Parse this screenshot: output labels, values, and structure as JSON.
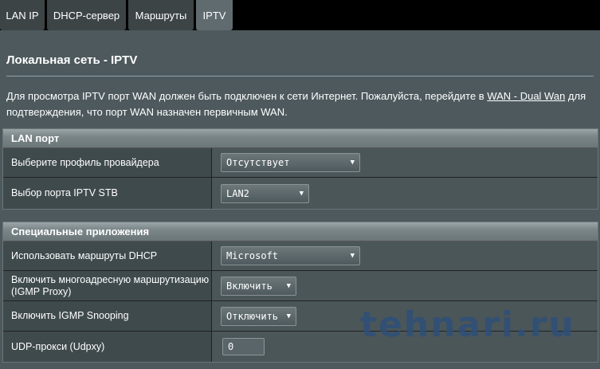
{
  "tabs": [
    {
      "label": "LAN IP",
      "active": false
    },
    {
      "label": "DHCP-сервер",
      "active": false
    },
    {
      "label": "Маршруты",
      "active": false
    },
    {
      "label": "IPTV",
      "active": true
    }
  ],
  "page": {
    "title": "Локальная сеть - IPTV",
    "description_before": "Для просмотра IPTV порт WAN должен быть подключен к сети Интернет. Пожалуйста, перейдите в ",
    "description_link": "WAN - Dual Wan",
    "description_after": " для подтверждения, что порт WAN назначен первичным WAN."
  },
  "sections": {
    "lan": {
      "header": "LAN порт",
      "provider_label": "Выберите профиль провайдера",
      "provider_value": "Отсутствует",
      "stb_label": "Выбор порта IPTV STB",
      "stb_value": "LAN2"
    },
    "apps": {
      "header": "Специальные приложения",
      "dhcp_routes_label": "Использовать маршруты DHCP",
      "dhcp_routes_value": "Microsoft",
      "igmp_proxy_label": "Включить многоадресную маршрутизацию (IGMP Proxy)",
      "igmp_proxy_value": "Включить",
      "igmp_snooping_label": "Включить IGMP Snooping",
      "igmp_snooping_value": "Отключить",
      "udpxy_label": "UDP-прокси (Udpxy)",
      "udpxy_value": "0"
    }
  },
  "icons": {
    "dropdown": "chevron-down-icon"
  },
  "watermark": "tehnari.ru",
  "colors": {
    "panel": "#4d595d",
    "tab_active": "#5f6b6f",
    "tab": "#3d4446"
  }
}
